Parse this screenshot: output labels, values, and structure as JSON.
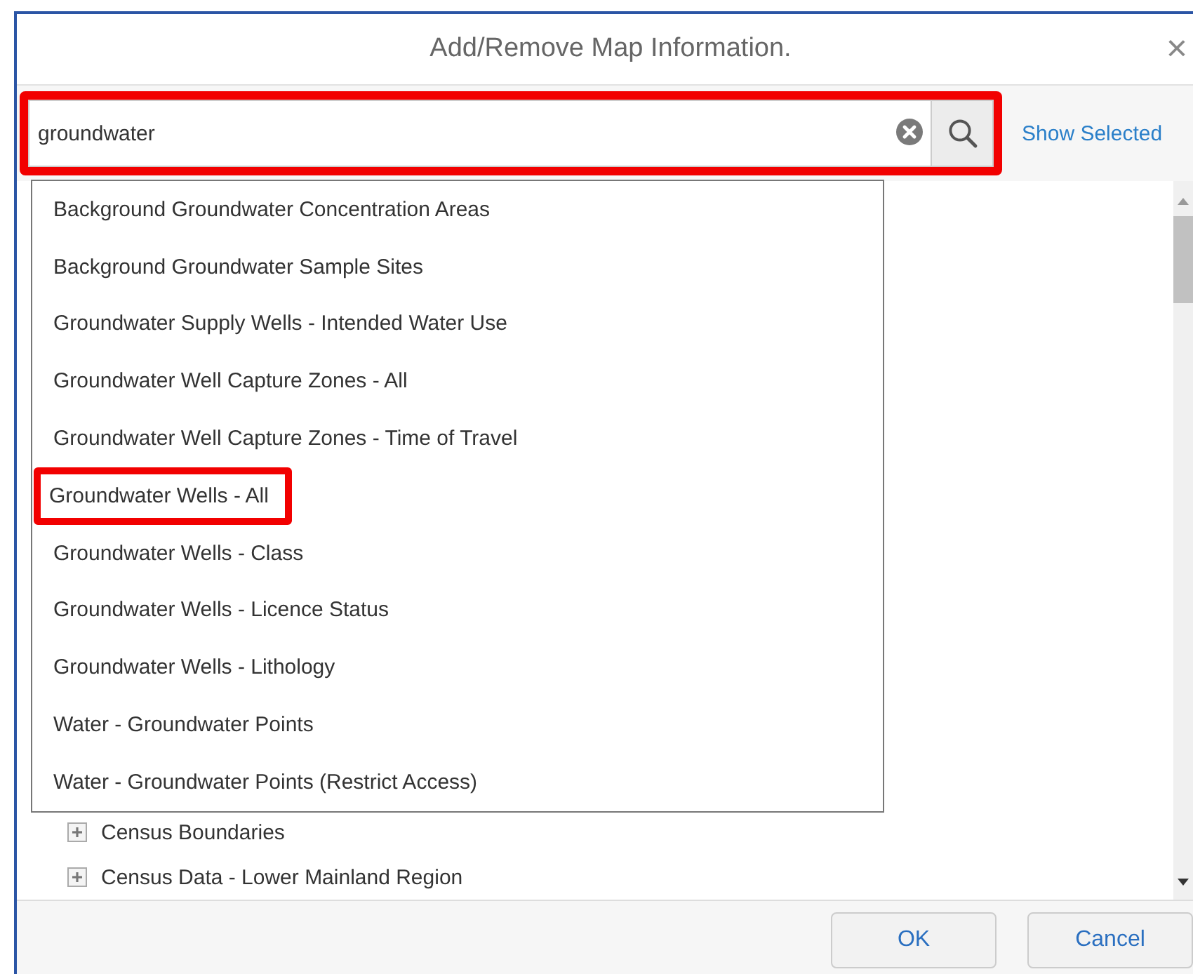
{
  "dialog": {
    "title": "Add/Remove Map Information.",
    "close": "×"
  },
  "search": {
    "value": "groundwater",
    "highlighted": true
  },
  "show_selected": "Show Selected",
  "suggestions": [
    {
      "label": "Background Groundwater Concentration Areas",
      "selected": false
    },
    {
      "label": "Background Groundwater Sample Sites",
      "selected": false
    },
    {
      "label": "Groundwater Supply Wells - Intended Water Use",
      "selected": false
    },
    {
      "label": "Groundwater Well Capture Zones - All",
      "selected": false
    },
    {
      "label": "Groundwater Well Capture Zones - Time of Travel",
      "selected": false
    },
    {
      "label": "Groundwater Wells - All",
      "selected": true
    },
    {
      "label": "Groundwater Wells - Class",
      "selected": false
    },
    {
      "label": "Groundwater Wells - Licence Status",
      "selected": false
    },
    {
      "label": "Groundwater Wells - Lithology",
      "selected": false
    },
    {
      "label": "Water - Groundwater Points",
      "selected": false
    },
    {
      "label": "Water - Groundwater Points (Restrict Access)",
      "selected": false
    }
  ],
  "tree": [
    {
      "label": "Census Boundaries",
      "expanded": false
    },
    {
      "label": "Census Data - Lower Mainland Region",
      "expanded": false
    }
  ],
  "buttons": [
    "OK",
    "Cancel"
  ]
}
